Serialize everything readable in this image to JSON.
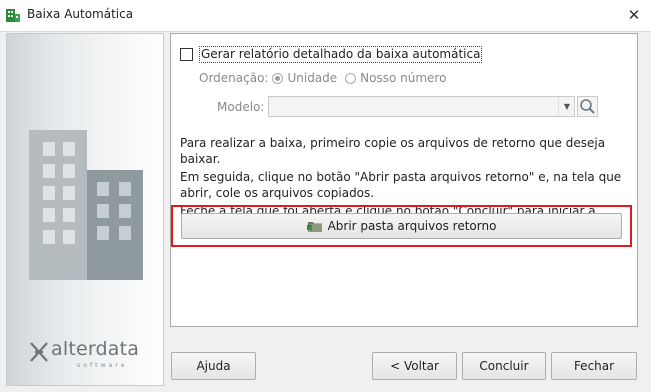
{
  "window": {
    "title": "Baixa Automática"
  },
  "brand": {
    "name": "alterdata",
    "subtitle": "software"
  },
  "options": {
    "detailed_report_label": "Gerar relatório detalhado da baixa automática",
    "detailed_report_checked": false,
    "ordering_label": "Ordenação:",
    "ordering_options": [
      "Unidade",
      "Nosso número"
    ],
    "ordering_selected": "Unidade",
    "model_label": "Modelo:",
    "model_value": ""
  },
  "instructions": {
    "line1": "Para realizar a baixa, primeiro copie os arquivos de retorno que deseja baixar.",
    "line2": "Em seguida, clique no botão \"Abrir pasta arquivos retorno\" e, na tela que abrir, cole os arquivos copiados.",
    "line3": "Feche a tela que foi aberta e clique no botão \"Concluir\" para iniciar a baixa."
  },
  "open_folder_label": "Abrir pasta arquivos retorno",
  "footer": {
    "help": "Ajuda",
    "back": "< Voltar",
    "finish": "Concluir",
    "close": "Fechar"
  },
  "colors": {
    "highlight": "#e01b1b",
    "icon_green": "#2e8b3e"
  }
}
